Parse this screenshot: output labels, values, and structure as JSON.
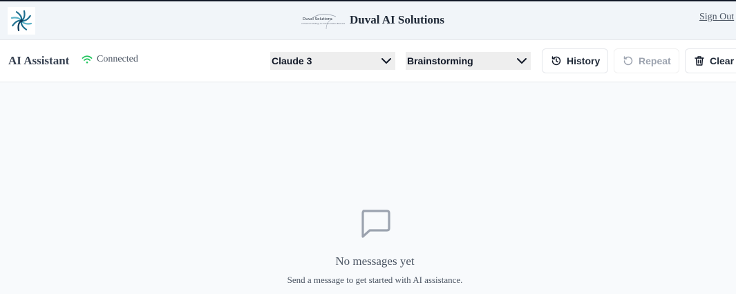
{
  "header": {
    "logo_icon": "pinwheel-logo-icon",
    "brand_logo_text": "Duval Solutions",
    "brand_logo_tagline": "AI Powered Strategy for Transformative Business",
    "brand_name": "Duval AI Solutions",
    "sign_out_label": "Sign Out"
  },
  "toolbar": {
    "title": "AI Assistant",
    "connection_status": "Connected",
    "connection_icon": "wifi-icon",
    "model_select": {
      "selected": "Claude 3"
    },
    "mode_select": {
      "selected": "Brainstorming"
    },
    "history_label": "History",
    "repeat_label": "Repeat",
    "clear_label": "Clear"
  },
  "empty_state": {
    "icon": "message-square-icon",
    "title": "No messages yet",
    "subtitle": "Send a message to get started with AI assistance."
  },
  "colors": {
    "connected": "#22c55e",
    "header_bg": "#f1f5f9",
    "page_bg": "#f8fafc",
    "logo_teal": "#1e6f8f"
  }
}
